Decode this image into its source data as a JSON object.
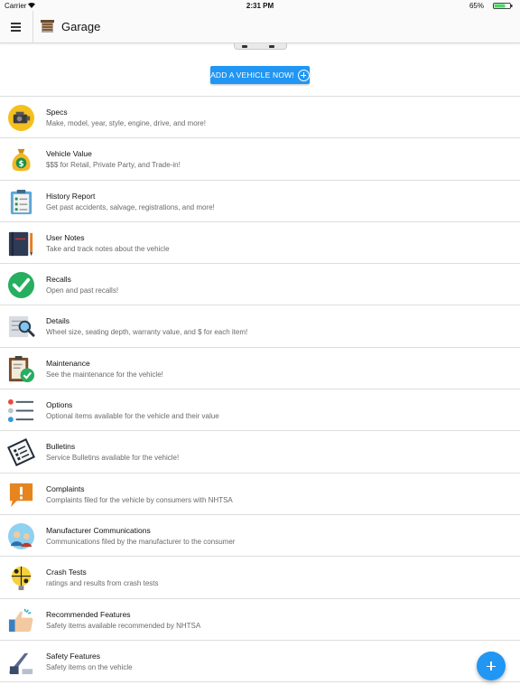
{
  "status_bar": {
    "carrier": "Carrier",
    "time": "2:31 PM",
    "battery": "65%"
  },
  "app_bar": {
    "title": "Garage",
    "menu_icon": "hamburger-menu-icon",
    "garage_icon": "garage-icon"
  },
  "hero": {
    "add_vehicle_label": "ADD A VEHICLE NOW!"
  },
  "items": [
    {
      "label": "Specs",
      "desc": "Make, model, year, style, engine, drive, and more!",
      "icon": "engine-icon"
    },
    {
      "label": "Vehicle Value",
      "desc": "$$$ for Retail, Private Party, and Trade-in!",
      "icon": "money-bag-icon"
    },
    {
      "label": "History Report",
      "desc": "Get past accidents, salvage, registrations, and more!",
      "icon": "clipboard-report-icon"
    },
    {
      "label": "User Notes",
      "desc": "Take and track notes about the vehicle",
      "icon": "notebook-icon"
    },
    {
      "label": "Recalls",
      "desc": "Open and past recalls!",
      "icon": "checkmark-icon"
    },
    {
      "label": "Details",
      "desc": "Wheel size, seating depth, warranty value, and $ for each item!",
      "icon": "magnifier-document-icon"
    },
    {
      "label": "Maintenance",
      "desc": "See the maintenance for the vehicle!",
      "icon": "maintenance-clipboard-icon"
    },
    {
      "label": "Options",
      "desc": "Optional items available for the vehicle and their value",
      "icon": "options-list-icon"
    },
    {
      "label": "Bulletins",
      "desc": "Service Bulletins available for the vehicle!",
      "icon": "bulletins-icon"
    },
    {
      "label": "Complaints",
      "desc": "Complaints filed for the vehicle by consumers with NHTSA",
      "icon": "alert-speech-icon"
    },
    {
      "label": "Manufacturer Communications",
      "desc": "Communications filed by the manufacturer to the consumer",
      "icon": "people-communication-icon"
    },
    {
      "label": "Crash Tests",
      "desc": "ratings and results from crash tests",
      "icon": "crash-test-dummy-icon"
    },
    {
      "label": "Recommended Features",
      "desc": "Safety items available recommended by NHTSA",
      "icon": "thumbs-up-icon"
    },
    {
      "label": "Safety Features",
      "desc": "Safety items on the vehicle",
      "icon": "seatbelt-icon"
    }
  ],
  "colors": {
    "accent": "#2196f3",
    "divider": "#dedede"
  }
}
